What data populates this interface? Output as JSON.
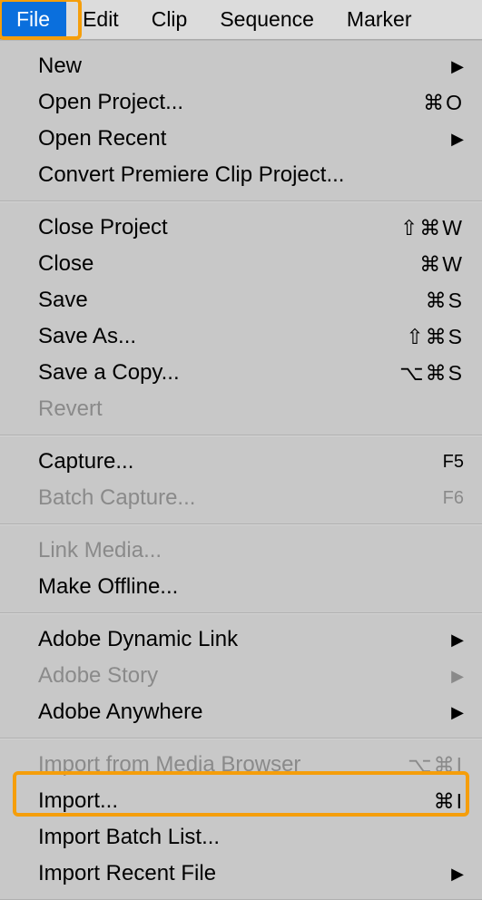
{
  "menubar": {
    "items": [
      {
        "label": "File",
        "selected": true
      },
      {
        "label": "Edit",
        "selected": false
      },
      {
        "label": "Clip",
        "selected": false
      },
      {
        "label": "Sequence",
        "selected": false
      },
      {
        "label": "Marker",
        "selected": false
      }
    ]
  },
  "menu": {
    "sections": [
      [
        {
          "label": "New",
          "shortcut": "",
          "submenu": true,
          "disabled": false
        },
        {
          "label": "Open Project...",
          "shortcut": "⌘O",
          "submenu": false,
          "disabled": false
        },
        {
          "label": "Open Recent",
          "shortcut": "",
          "submenu": true,
          "disabled": false
        },
        {
          "label": "Convert Premiere Clip Project...",
          "shortcut": "",
          "submenu": false,
          "disabled": false
        }
      ],
      [
        {
          "label": "Close Project",
          "shortcut": "⇧⌘W",
          "submenu": false,
          "disabled": false
        },
        {
          "label": "Close",
          "shortcut": "⌘W",
          "submenu": false,
          "disabled": false
        },
        {
          "label": "Save",
          "shortcut": "⌘S",
          "submenu": false,
          "disabled": false
        },
        {
          "label": "Save As...",
          "shortcut": "⇧⌘S",
          "submenu": false,
          "disabled": false
        },
        {
          "label": "Save a Copy...",
          "shortcut": "⌥⌘S",
          "submenu": false,
          "disabled": false
        },
        {
          "label": "Revert",
          "shortcut": "",
          "submenu": false,
          "disabled": true
        }
      ],
      [
        {
          "label": "Capture...",
          "shortcut": "F5",
          "submenu": false,
          "disabled": false,
          "fn": true
        },
        {
          "label": "Batch Capture...",
          "shortcut": "F6",
          "submenu": false,
          "disabled": true,
          "fn": true
        }
      ],
      [
        {
          "label": "Link Media...",
          "shortcut": "",
          "submenu": false,
          "disabled": true
        },
        {
          "label": "Make Offline...",
          "shortcut": "",
          "submenu": false,
          "disabled": false
        }
      ],
      [
        {
          "label": "Adobe Dynamic Link",
          "shortcut": "",
          "submenu": true,
          "disabled": false
        },
        {
          "label": "Adobe Story",
          "shortcut": "",
          "submenu": true,
          "disabled": true
        },
        {
          "label": "Adobe Anywhere",
          "shortcut": "",
          "submenu": true,
          "disabled": false
        }
      ],
      [
        {
          "label": "Import from Media Browser",
          "shortcut": "⌥⌘I",
          "submenu": false,
          "disabled": true
        },
        {
          "label": "Import...",
          "shortcut": "⌘I",
          "submenu": false,
          "disabled": false,
          "highlighted": true
        },
        {
          "label": "Import Batch List...",
          "shortcut": "",
          "submenu": false,
          "disabled": false
        },
        {
          "label": "Import Recent File",
          "shortcut": "",
          "submenu": true,
          "disabled": false
        }
      ]
    ]
  }
}
